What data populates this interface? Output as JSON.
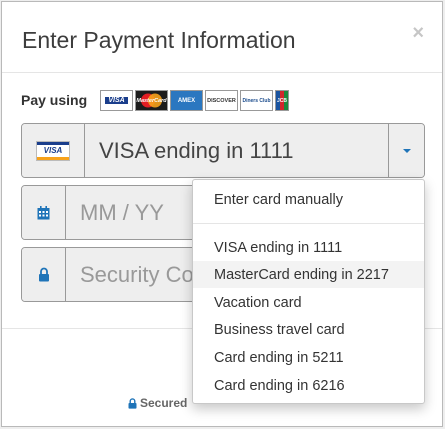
{
  "modal": {
    "title": "Enter Payment Information",
    "close": "×",
    "pay_using_label": "Pay using",
    "accepted_cards": [
      {
        "icon": "visa-card-icon",
        "label": "VISA"
      },
      {
        "icon": "mastercard-card-icon",
        "label": "MasterCard"
      },
      {
        "icon": "amex-card-icon",
        "label": "AMEX"
      },
      {
        "icon": "discover-card-icon",
        "label": "DISCOVER"
      },
      {
        "icon": "diners-club-card-icon",
        "label": "Diners Club"
      },
      {
        "icon": "jcb-card-icon",
        "label": "JCB"
      }
    ],
    "card_select": {
      "card_icon_label": "VISA",
      "value": "VISA ending in 1111",
      "caret_icon": "caret-down-icon"
    },
    "expiry": {
      "placeholder": "MM / YY",
      "icon": "calendar-icon"
    },
    "security_code": {
      "placeholder": "Security Code",
      "icon": "lock-icon"
    },
    "footer": {
      "secured_text": "Secured",
      "icon": "lock-icon"
    }
  },
  "dropdown": {
    "manual": "Enter card manually",
    "items": [
      "VISA ending in 1111",
      "MasterCard ending in 2217",
      "Vacation card",
      "Business travel card",
      "Card ending in 5211",
      "Card ending in 6216"
    ],
    "highlighted_item": "MasterCard ending in 2217"
  },
  "colors": {
    "accent": "#1f74b8",
    "addon_bg": "#eeeeee",
    "border": "#999999"
  }
}
